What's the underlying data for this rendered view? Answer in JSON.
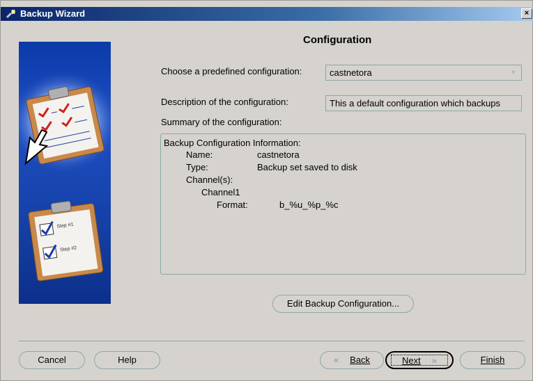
{
  "window": {
    "title": "Backup Wizard",
    "close_glyph": "×"
  },
  "page": {
    "heading": "Configuration"
  },
  "predefined": {
    "label": "Choose a predefined configuration:",
    "value": "castnetora"
  },
  "description": {
    "label": "Description of the configuration:",
    "value": "This a default configuration which backups"
  },
  "summary": {
    "label": "Summary of the configuration:",
    "header": "Backup Configuration Information:",
    "name_key": "Name:",
    "name_value": "castnetora",
    "type_key": "Type:",
    "type_value": "Backup set saved to disk",
    "channels_key": "Channel(s):",
    "channel1": "Channel1",
    "format_key": "Format:",
    "format_value": "b_%u_%p_%c"
  },
  "buttons": {
    "edit": "Edit Backup Configuration...",
    "cancel": "Cancel",
    "help": "Help",
    "back": "Back",
    "next": "Next",
    "finish": "Finish"
  },
  "illustration": {
    "step1": "Step #1",
    "step2": "Step #2"
  },
  "colors": {
    "face": "#d6d3ce",
    "titlebar": "#0a246a",
    "panel": "#1540a6",
    "border": "#8aa8a4"
  }
}
